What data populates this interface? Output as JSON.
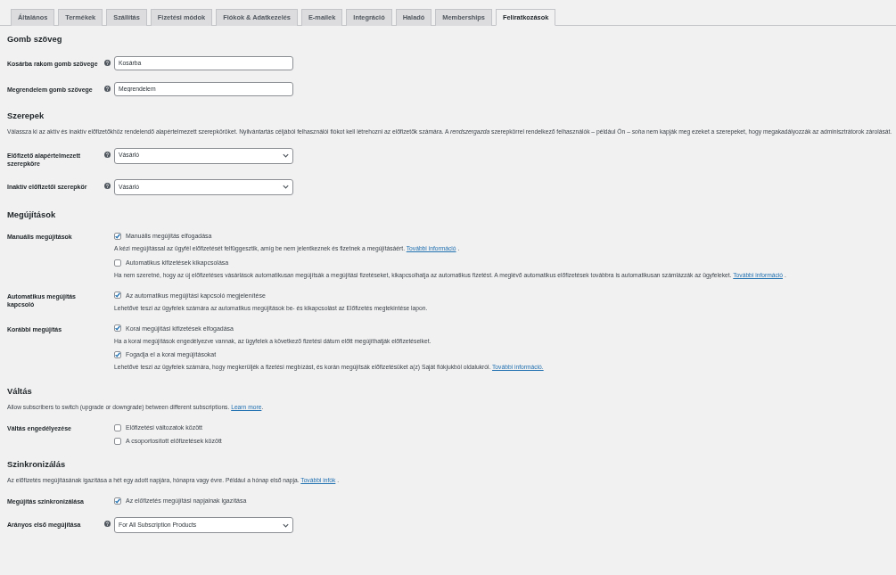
{
  "tabs": [
    {
      "label": "Általános",
      "selected": false
    },
    {
      "label": "Termékek",
      "selected": false
    },
    {
      "label": "Szállítás",
      "selected": false
    },
    {
      "label": "Fizetési módok",
      "selected": false
    },
    {
      "label": "Fiókok & Adatkezelés",
      "selected": false
    },
    {
      "label": "E-mailek",
      "selected": false
    },
    {
      "label": "Integráció",
      "selected": false
    },
    {
      "label": "Haladó",
      "selected": false
    },
    {
      "label": "Memberships",
      "selected": false
    },
    {
      "label": "Feliratkozások",
      "selected": true
    }
  ],
  "sections": [
    {
      "title": "Gomb szöveg",
      "rows": [
        {
          "label": "Kosárba rakom gomb szövege",
          "help": true,
          "kind": "text",
          "value": "Kosárba"
        },
        {
          "label": "Megrendelem gomb szövege",
          "help": true,
          "kind": "text",
          "value": "Megrendelem"
        }
      ]
    },
    {
      "title": "Szerepek",
      "description": {
        "text": "Válassza ki az aktív és inaktív előfizetőkhöz rendelendő alapértelmezett szerepköröket. Nyilvántartás céljából felhasználói fiókot kell létrehozni az előfizetők számára. A *rendszergazda* szerepkörrel rendelkező felhasználók – például Ön – *soha* nem kapják meg ezeket a szerepeket, hogy megakadályozzák az adminisztrátorok zárolását."
      },
      "rows": [
        {
          "label": "Előfizető alapértelmezett szerepköre",
          "help": true,
          "kind": "select",
          "value": "Vásárló"
        },
        {
          "label": "Inaktív előfizetői szerepkör",
          "help": true,
          "kind": "select",
          "value": "Vásárló"
        }
      ]
    },
    {
      "title": "Megújítások",
      "rows": [
        {
          "label": "Manuális megújítások",
          "help": false,
          "kind": "checks",
          "options": [
            {
              "label": "Manuális megújítás elfogadása",
              "checked": true,
              "description": {
                "text": "A kézi megújítással az ügyfél előfizetését felfüggesztik, amíg be nem jelentkeznek és fizetnek a megújításáért.",
                "link": "További információ",
                "after": " ."
              }
            },
            {
              "label": "Automatikus kifizetések kikapcsolása",
              "checked": false,
              "description": {
                "text": "Ha nem szeretné, hogy az új előfizetéses vásárlások automatikusan megújítsák a megújítási fizetéseket, kikapcsolhatja az automatikus fizetést. A meglévő automatikus előfizetések továbbra is automatikusan számlázzák az ügyfeleket.",
                "link": "További információ",
                "after": " ."
              }
            }
          ]
        },
        {
          "label": "Automatikus megújítás kapcsoló",
          "help": false,
          "kind": "checks",
          "options": [
            {
              "label": "Az automatikus megújítási kapcsoló megjelenítése",
              "checked": true,
              "description": {
                "text": "Lehetővé teszi az ügyfelek számára az automatikus megújítások be- és kikapcsolást az Előfizetés megtekintése lapon."
              }
            }
          ]
        },
        {
          "label": "Korábbi megújítás",
          "help": false,
          "kind": "checks",
          "options": [
            {
              "label": "Korai megújítási kifizetések elfogadása",
              "checked": true,
              "description": {
                "text": "Ha a korai megújítások engedélyezve vannak, az ügyfelek a következő fizetési dátum előtt megújíthatják előfizetéseiket."
              }
            },
            {
              "label": "Fogadja el a korai megújításokat",
              "checked": true,
              "description": {
                "text": "Lehetővé teszi az ügyfelek számára, hogy megkerüljék a fizetési megbízást, és korán megújítsák előfizetésüket a(z) Saját fiókjukból oldalukról.",
                "link": "További információ."
              }
            }
          ]
        }
      ]
    },
    {
      "title": "Váltás",
      "description": {
        "text": "Allow subscribers to switch (upgrade or downgrade) between different subscriptions.",
        "link": "Learn more",
        "after": "."
      },
      "rows": [
        {
          "label": "Váltás engedélyezése",
          "help": false,
          "kind": "checks",
          "options": [
            {
              "label": "Előfizetési változatok között",
              "checked": false
            },
            {
              "label": "A csoportosított előfizetések között",
              "checked": false
            }
          ]
        }
      ]
    },
    {
      "title": "Szinkronizálás",
      "description": {
        "text": "Az előfizetés megújításának igazítása a hét egy adott napjára, hónapra vagy évre. Például a hónap első napja.",
        "link": "További infók",
        "after": " ."
      },
      "rows": [
        {
          "label": "Megújítás szinkronizálása",
          "help": false,
          "kind": "checks",
          "options": [
            {
              "label": "Az előfizetés megújítási napjainak igazítása",
              "checked": true
            }
          ]
        },
        {
          "label": "Arányos első megújítása",
          "help": true,
          "kind": "select",
          "value": "For All Subscription Products"
        }
      ]
    }
  ]
}
